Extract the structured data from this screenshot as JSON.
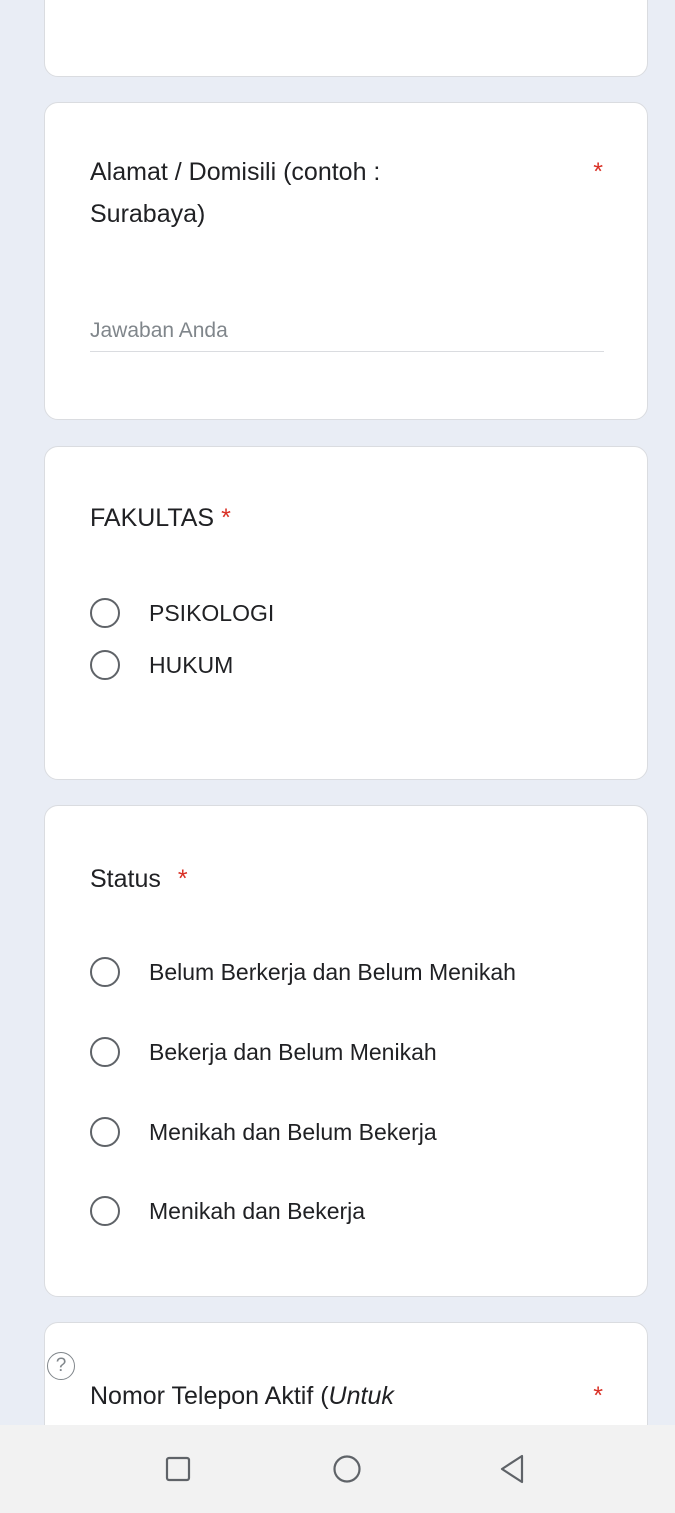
{
  "cards": {
    "alamat": {
      "title_line1": "Alamat / Domisili (contoh :",
      "title_line2": "Surabaya)",
      "required": "*",
      "input_placeholder": "Jawaban Anda",
      "input_value": ""
    },
    "fakultas": {
      "title": "FAKULTAS",
      "required": "*",
      "options": [
        "PSIKOLOGI",
        "HUKUM"
      ],
      "selected": null
    },
    "status": {
      "title": "Status",
      "required": "*",
      "options": [
        "Belum Berkerja dan Belum Menikah",
        "Bekerja dan Belum Menikah",
        "Menikah dan Belum Bekerja",
        "Menikah dan Bekerja"
      ],
      "selected": null
    },
    "telepon": {
      "title_prefix": "Nomor Telepon Aktif (",
      "title_italic": "Untuk",
      "required": "*"
    }
  },
  "help": {
    "icon": "help-circle-icon",
    "glyph": "?"
  },
  "navbar": {
    "recents_icon": "square-icon",
    "home_icon": "circle-icon",
    "back_icon": "triangle-back-icon"
  },
  "colors": {
    "background": "#e9edf5",
    "card": "#ffffff",
    "required": "#d93025",
    "radio_border": "#5f6368",
    "placeholder": "#80868b"
  }
}
